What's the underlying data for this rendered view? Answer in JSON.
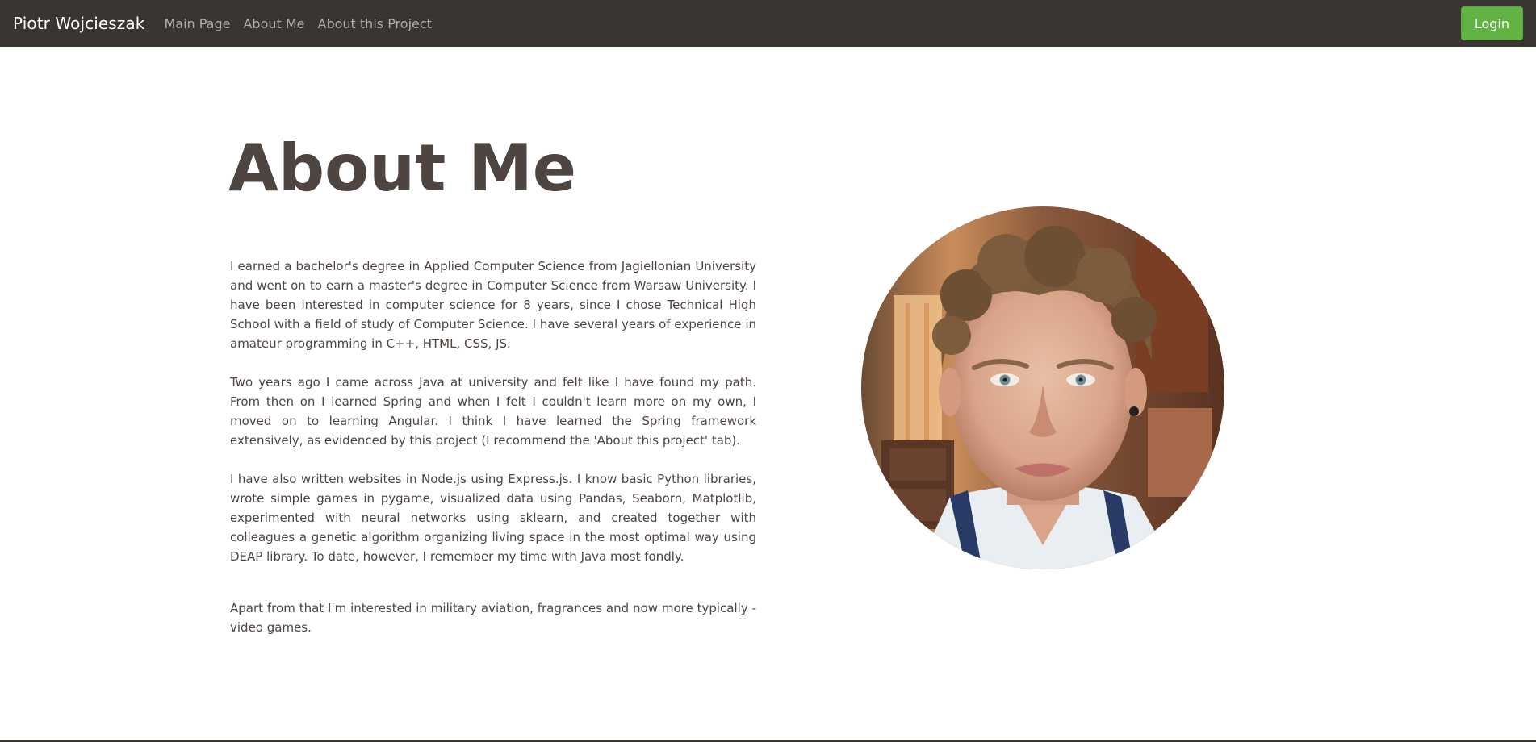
{
  "navbar": {
    "brand": "Piotr Wojcieszak",
    "links": [
      "Main Page",
      "About Me",
      "About this Project"
    ],
    "login_label": "Login"
  },
  "main": {
    "title": "About Me",
    "paragraphs": [
      "I earned a bachelor's degree in Applied Computer Science from Jagiellonian University and went on to earn a master's degree in Computer Science from Warsaw University. I have been interested in computer science for 8 years, since I chose Technical High School with a field of study of Computer Science. I have several years of experience in amateur programming in C++, HTML, CSS, JS.",
      "Two years ago I came across Java at university and felt like I have found my path. From then on I learned Spring and when I felt I couldn't learn more on my own, I moved on to learning Angular. I think I have learned the Spring framework extensively, as evidenced by this project (I recommend the 'About this project' tab).",
      "I have also written websites in Node.js using Express.js. I know basic Python libraries, wrote simple games in pygame, visualized data using Pandas, Seaborn, Matplotlib, experimented with neural networks using sklearn, and created together with colleagues a genetic algorithm organizing living space in the most optimal way using DEAP library. To date, however, I remember my time with Java most fondly.",
      "Apart from that I'm interested in military aviation, fragrances and now more typically - video games."
    ]
  },
  "colors": {
    "navbar_bg": "#3a3532",
    "accent": "#62b343",
    "text": "#4e4440"
  }
}
